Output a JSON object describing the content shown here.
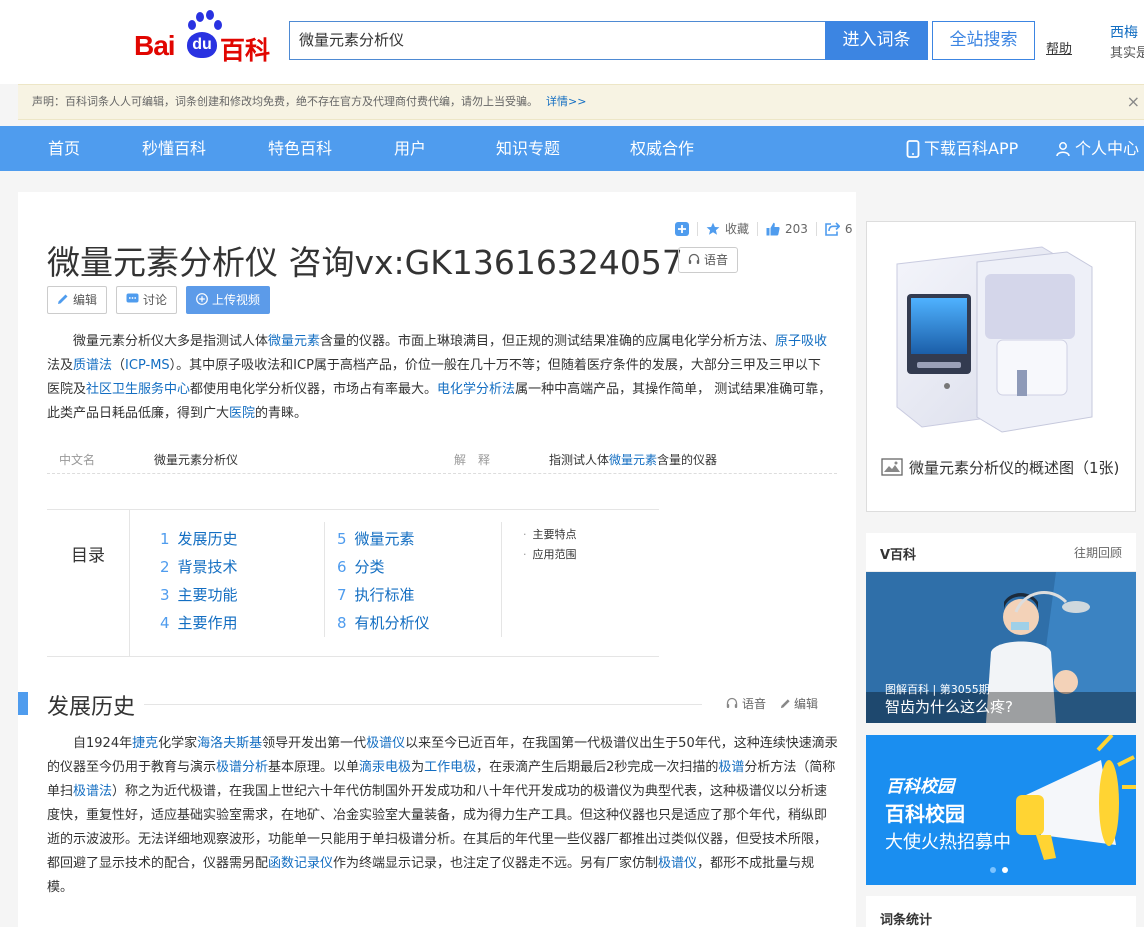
{
  "header": {
    "logo_text": "Baidu百科",
    "search_value": "微量元素分析仪",
    "enter_label": "进入词条",
    "site_search_label": "全站搜索",
    "help_label": "帮助",
    "user_name": "西梅",
    "user_sub": "其实是"
  },
  "notice": {
    "text": "声明：百科词条人人可编辑，词条创建和修改均免费，绝不存在官方及代理商付费代编，请勿上当受骗。",
    "more": "详情>>",
    "close": "×"
  },
  "nav": {
    "items": [
      "首页",
      "秒懂百科",
      "特色百科",
      "用户",
      "知识专题",
      "权威合作"
    ],
    "download": "下载百科APP",
    "personal": "个人中心"
  },
  "toolbar": {
    "collect": "收藏",
    "likes": "203",
    "shares": "6"
  },
  "article": {
    "title": "微量元素分析仪 咨询vx:GK13616324057",
    "voice": "语音",
    "edit": "编辑",
    "discuss": "讨论",
    "upload": "上传视频",
    "summary": {
      "p1": "微量元素分析仪大多是指测试人体",
      "l1": "微量元素",
      "p2": "含量的仪器。市面上琳琅满目，但正规的测试结果准确的应属电化学分析方法、",
      "l2": "原子吸收",
      "p3": "法及",
      "l3": "质谱法",
      "p4": "（",
      "l4": "ICP-MS",
      "p5": "）。其中原子吸收法和ICP属于高档产品，价位一般在几十万不等；但随着医疗条件的发展，大部分三甲及三甲以下医院及",
      "l5": "社区卫生服务中心",
      "p6": "都使用电化学分析仪器，市场占有率最大。",
      "l6": "电化学分析法",
      "p7": "属一种中高端产品，其操作简单， 测试结果准确可靠，此类产品日耗品低廉，得到广大",
      "l7": "医院",
      "p8": "的青睐。"
    },
    "basic": {
      "k1": "中文名",
      "v1": "微量元素分析仪",
      "k2": "解　释",
      "v2a": "指测试人体",
      "v2l": "微量元素",
      "v2b": "含量的仪器"
    },
    "catalog": {
      "label": "目录",
      "items": [
        {
          "num": "1",
          "label": "发展历史"
        },
        {
          "num": "2",
          "label": "背景技术"
        },
        {
          "num": "3",
          "label": "主要功能"
        },
        {
          "num": "4",
          "label": "主要作用"
        },
        {
          "num": "5",
          "label": "微量元素"
        },
        {
          "num": "6",
          "label": "分类"
        },
        {
          "num": "7",
          "label": "执行标准"
        },
        {
          "num": "8",
          "label": "有机分析仪"
        }
      ],
      "subs": [
        "主要特点",
        "应用范围"
      ]
    },
    "section": {
      "title": "发展历史",
      "voice": "语音",
      "edit": "编辑",
      "t1": "自1924年",
      "a1": "捷克",
      "t2": "化学家",
      "a2": "海洛夫斯基",
      "t3": "领导开发出第一代",
      "a3": "极谱仪",
      "t4": "以来至今已近百年，在我国第一代极谱仪出生于50年代，这种连续快速滴汞的仪器至今仍用于教育与演示",
      "a4": "极谱分析",
      "t5": "基本原理。以单",
      "a5": "滴汞电极",
      "t6": "为",
      "a6": "工作电极",
      "t7": "，在汞滴产生后期最后2秒完成一次扫描的",
      "a7": "极谱",
      "t8": "分析方法（简称单扫",
      "a8": "极谱法",
      "t9": "）称之为近代极谱，在我国上世纪六十年代仿制国外开发成功和八十年代开发成功的极谱仪为典型代表，这种极谱仪以分析速度快，重复性好，适应基础实验室需求，在地矿、冶金实验室大量装备，成为得力生产工具。但这种仪器也只是适应了那个年代，稍纵即逝的示波波形。无法详细地观察波形，功能单一只能用于单扫极谱分析。在其后的年代里一些仪器厂都推出过类似仪器，但受技术所限，都回避了显示技术的配合，仪器需另配",
      "a9": "函数记录仪",
      "t10": "作为终端显示记录，也注定了仪器走不远。另有厂家仿制",
      "a10": "极谱仪",
      "t11": "，都形不成批量与规模。"
    }
  },
  "sidebar": {
    "image_caption": "微量元素分析仪的概述图（1张)",
    "vbaike_title": "V百科",
    "vbaike_more": "往期回顾",
    "vbaike_tag": "图解百科 | 第3055期",
    "vbaike_video_title": "智齿为什么这么疼?",
    "campus_logo": "百科校园",
    "campus_title": "百科校园",
    "campus_sub": "大使火热招募中",
    "stats_title": "词条统计"
  },
  "colors": {
    "brand_blue": "#4f9cee",
    "link": "#136ec2",
    "baidu_red": "#e10601"
  }
}
